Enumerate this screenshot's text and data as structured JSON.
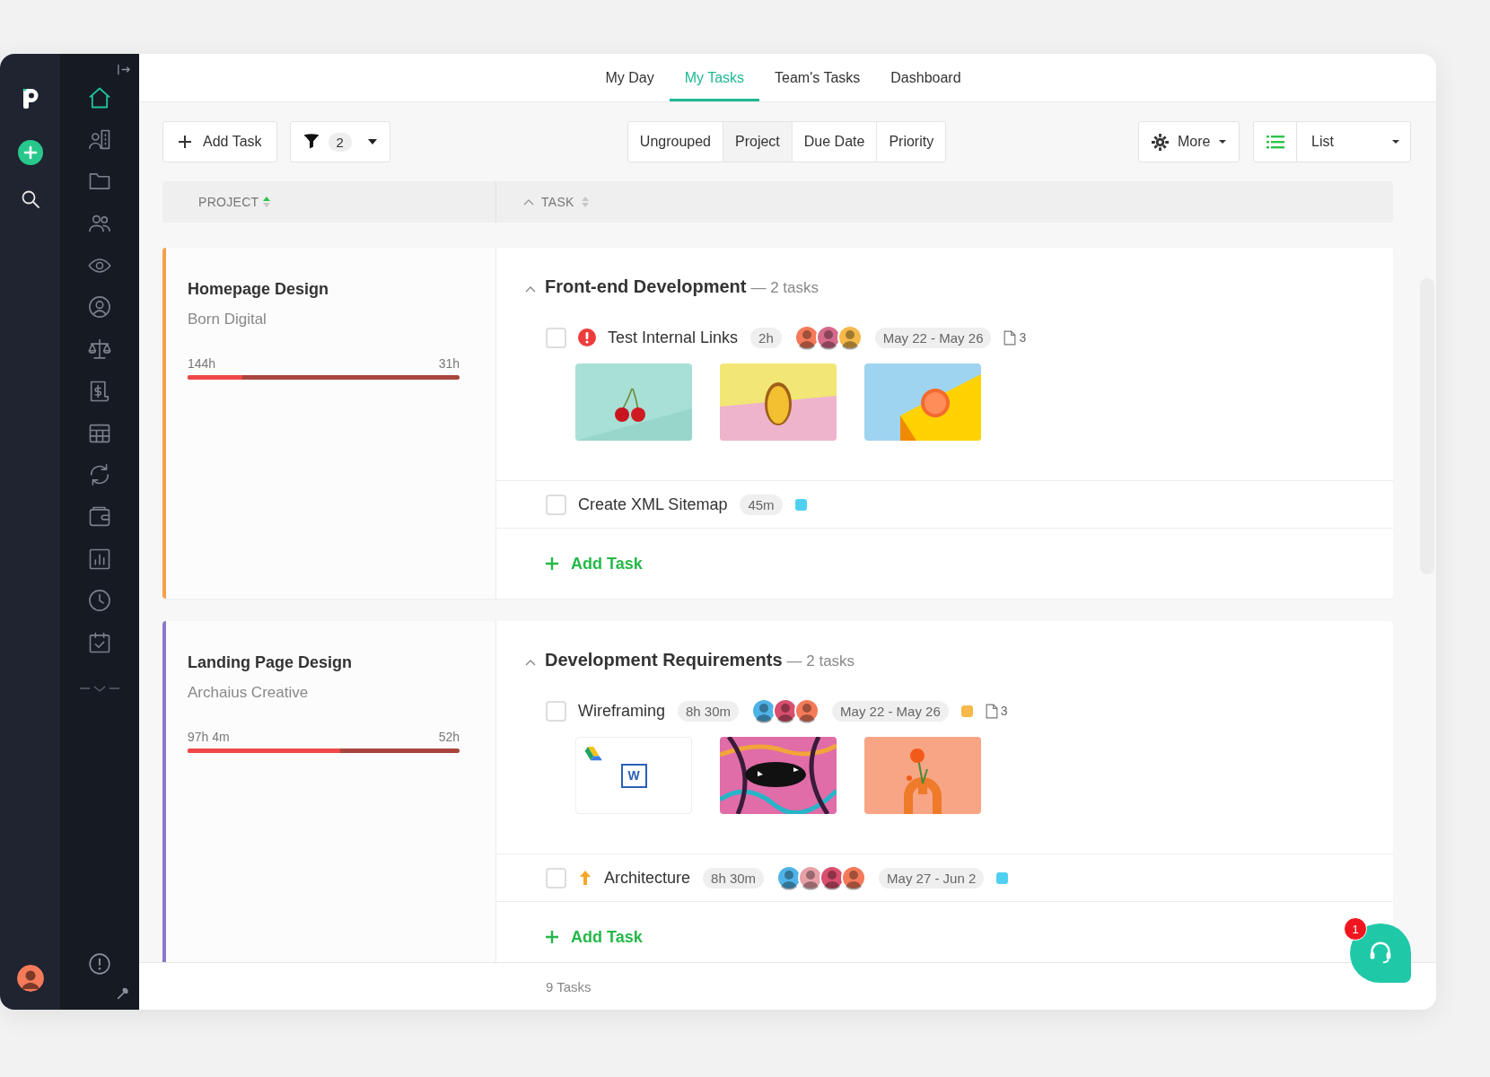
{
  "nav": {
    "tabs": [
      {
        "label": "My Day",
        "selected": false
      },
      {
        "label": "My Tasks",
        "selected": true
      },
      {
        "label": "Team's Tasks",
        "selected": false
      },
      {
        "label": "Dashboard",
        "selected": false
      }
    ]
  },
  "sidebar": {
    "items": [
      {
        "kind": "home",
        "selected": true
      },
      {
        "kind": "contacts",
        "selected": false
      },
      {
        "kind": "folder",
        "selected": false
      },
      {
        "kind": "people",
        "selected": false
      },
      {
        "kind": "eye",
        "selected": false
      },
      {
        "kind": "user",
        "selected": false
      },
      {
        "kind": "scale",
        "selected": false
      },
      {
        "kind": "invoice",
        "selected": false
      },
      {
        "kind": "table",
        "selected": false
      },
      {
        "kind": "refresh",
        "selected": false
      },
      {
        "kind": "wallet",
        "selected": false
      },
      {
        "kind": "chart",
        "selected": false
      },
      {
        "kind": "clock",
        "selected": false
      },
      {
        "kind": "calendar",
        "selected": false
      }
    ]
  },
  "toolbar": {
    "add_task": "Add Task",
    "filter_count": "2",
    "grouping": [
      {
        "label": "Ungrouped",
        "selected": false
      },
      {
        "label": "Project",
        "selected": true
      },
      {
        "label": "Due Date",
        "selected": false
      },
      {
        "label": "Priority",
        "selected": false
      }
    ],
    "more": "More",
    "view": "List"
  },
  "columns": [
    {
      "label": "PROJECT",
      "sorted": true
    },
    {
      "label": "TASK",
      "sorted": false
    }
  ],
  "projects": [
    {
      "name": "Homepage Design",
      "client": "Born Digital",
      "color": "#f5a04a",
      "spent": "144h",
      "remaining": "31h",
      "level": 0.2,
      "group": {
        "title": "Front-end Development",
        "count": "— 2 tasks",
        "expanded": true,
        "add_task": "Add Task",
        "tasks": [
          {
            "name": "Test Internal Links",
            "checked": false,
            "urgent": true,
            "high": false,
            "duration": "2h",
            "avatars": [
              {
                "color": "#f47a5a"
              },
              {
                "color": "#d66a8a"
              },
              {
                "color": "#f5b94a"
              }
            ],
            "dates": "May 22 - May 26",
            "files": "3",
            "attachments": [
              {
                "kind": "picture"
              },
              {
                "kind": "picture"
              },
              {
                "kind": "picture"
              }
            ]
          },
          {
            "name": "Create XML Sitemap",
            "checked": false,
            "urgent": false,
            "high": false,
            "duration": "45m",
            "color": "#4fd0f0"
          }
        ]
      }
    },
    {
      "name": "Landing Page Design",
      "client": "Archaius Creative",
      "color": "#8a78c8",
      "spent": "97h 4m",
      "remaining": "52h",
      "level": 0.56,
      "group": {
        "title": "Development Requirements",
        "count": "— 2 tasks",
        "expanded": true,
        "add_task": "Add Task",
        "tasks": [
          {
            "name": "Wireframing",
            "checked": false,
            "urgent": false,
            "high": false,
            "duration": "8h 30m",
            "avatars": [
              {
                "color": "#4fb3e8"
              },
              {
                "color": "#d94f6e"
              },
              {
                "color": "#f47a5a"
              }
            ],
            "dates": "May 22 - May 26",
            "color": "#f7b84a",
            "files": "3",
            "attachments": [
              {
                "kind": "document",
                "label": "W"
              },
              {
                "kind": "picture"
              },
              {
                "kind": "picture"
              }
            ]
          },
          {
            "name": "Architecture",
            "checked": false,
            "urgent": false,
            "high": true,
            "duration": "8h 30m",
            "avatars": [
              {
                "color": "#4fb3e8"
              },
              {
                "color": "#e8a0a8"
              },
              {
                "color": "#d94f6e"
              },
              {
                "color": "#f47a5a"
              }
            ],
            "dates": "May 27 - Jun 2",
            "color": "#4fd0f0"
          }
        ]
      }
    }
  ],
  "status_bar": {
    "count": "9 Tasks"
  },
  "support": {
    "badge": "1"
  }
}
